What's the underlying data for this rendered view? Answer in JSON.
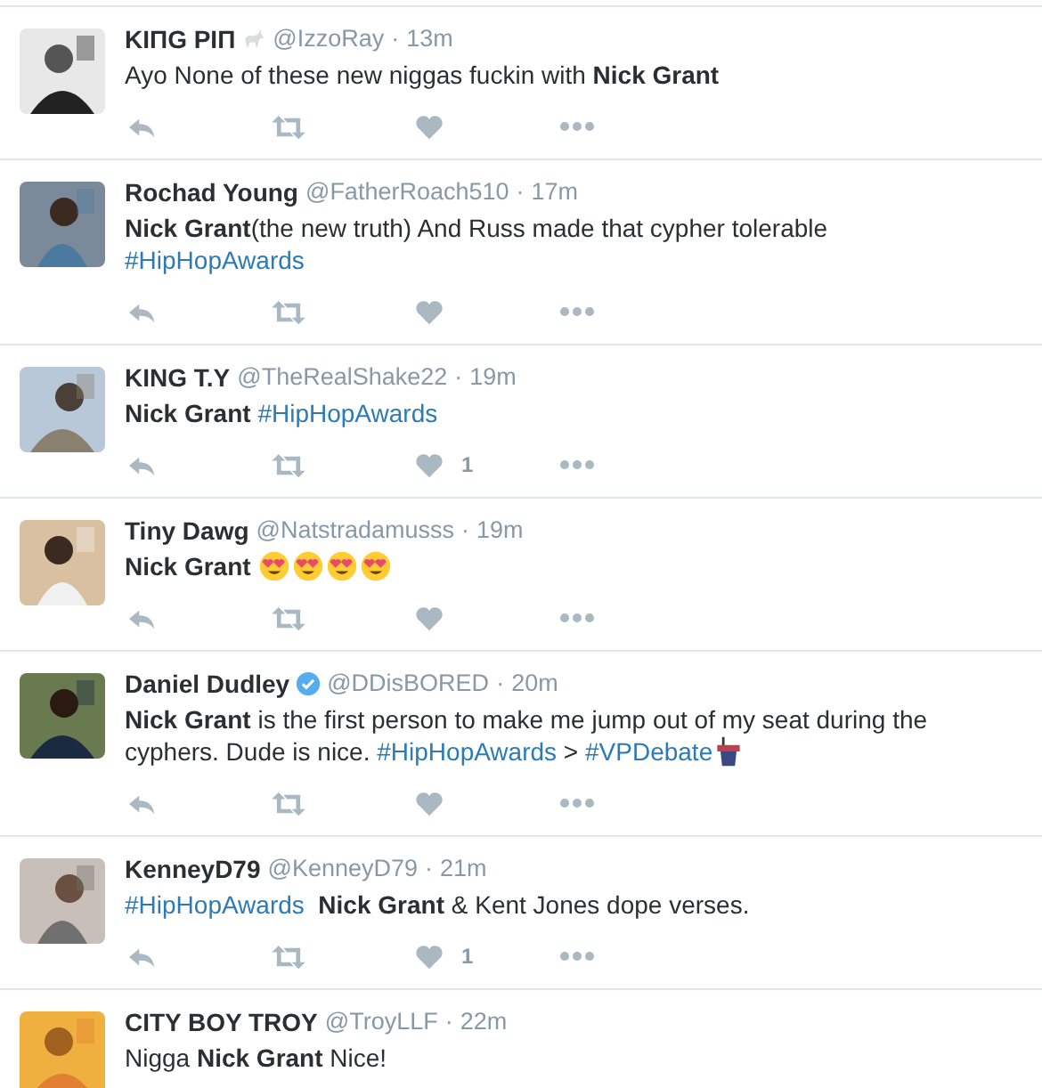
{
  "tweets": [
    {
      "name": "KIПG PIП",
      "goat_emoji": true,
      "verified": false,
      "handle": "@IzzoRay",
      "separator": "·",
      "time": "13m",
      "avatar": {
        "kind": "picture"
      },
      "text": [
        {
          "kind": "plain",
          "text": "Ayo None of these new niggas fuckin with "
        },
        {
          "kind": "bold",
          "text": "Nick Grant"
        }
      ]
    },
    {
      "name": "Rochad Young",
      "goat_emoji": false,
      "verified": false,
      "handle": "@FatherRoach510",
      "separator": "·",
      "time": "17m",
      "avatar": {
        "kind": "picture"
      },
      "text": [
        {
          "kind": "bold",
          "text": "Nick Grant"
        },
        {
          "kind": "plain",
          "text": "(the new truth) And Russ made that cypher tolerable "
        },
        {
          "kind": "hashtag",
          "text": "#HipHopAwards"
        }
      ]
    },
    {
      "name": "KING T.Y",
      "goat_emoji": false,
      "verified": false,
      "handle": "@TheRealShake22",
      "separator": "·",
      "time": "19m",
      "avatar": {
        "kind": "picture"
      },
      "text": [
        {
          "kind": "bold",
          "text": "Nick Grant "
        },
        {
          "kind": "hashtag",
          "text": "#HipHopAwards"
        }
      ],
      "likes": "1"
    },
    {
      "name": "Tiny Dawg",
      "goat_emoji": false,
      "verified": false,
      "handle": "@Natstradamusss",
      "separator": "·",
      "time": "19m",
      "avatar": {
        "kind": "picture"
      },
      "text": [
        {
          "kind": "bold",
          "text": "Nick Grant "
        },
        {
          "kind": "heart-eyes"
        },
        {
          "kind": "heart-eyes"
        },
        {
          "kind": "heart-eyes"
        },
        {
          "kind": "heart-eyes"
        }
      ]
    },
    {
      "name": "Daniel Dudley",
      "goat_emoji": false,
      "verified": true,
      "handle": "@DDisBORED",
      "separator": "·",
      "time": "20m",
      "avatar": {
        "kind": "picture"
      },
      "text": [
        {
          "kind": "bold",
          "text": "Nick Grant"
        },
        {
          "kind": "plain",
          "text": " is the first person to make me jump out of my seat during the cyphers. Dude is nice. "
        },
        {
          "kind": "hashtag",
          "text": "#HipHopAwards"
        },
        {
          "kind": "plain",
          "text": " > "
        },
        {
          "kind": "hashtag",
          "text": "#VPDebate"
        },
        {
          "kind": "podium"
        }
      ]
    },
    {
      "name": "KenneyD79",
      "goat_emoji": false,
      "verified": false,
      "handle": "@KenneyD79",
      "separator": "·",
      "time": "21m",
      "avatar": {
        "kind": "picture"
      },
      "text": [
        {
          "kind": "hashtag",
          "text": "#HipHopAwards"
        },
        {
          "kind": "bold",
          "text": "  Nick Grant"
        },
        {
          "kind": "plain",
          "text": " & Kent Jones dope verses."
        }
      ],
      "likes": "1"
    },
    {
      "name": "CITY BOY TROY",
      "goat_emoji": false,
      "verified": false,
      "handle": "@TroyLLF",
      "separator": "·",
      "time": "22m",
      "avatar": {
        "kind": "picture"
      },
      "text": [
        {
          "kind": "plain",
          "text": "Nigga "
        },
        {
          "kind": "bold",
          "text": "Nick Grant"
        },
        {
          "kind": "plain",
          "text": " Nice!"
        }
      ]
    }
  ]
}
